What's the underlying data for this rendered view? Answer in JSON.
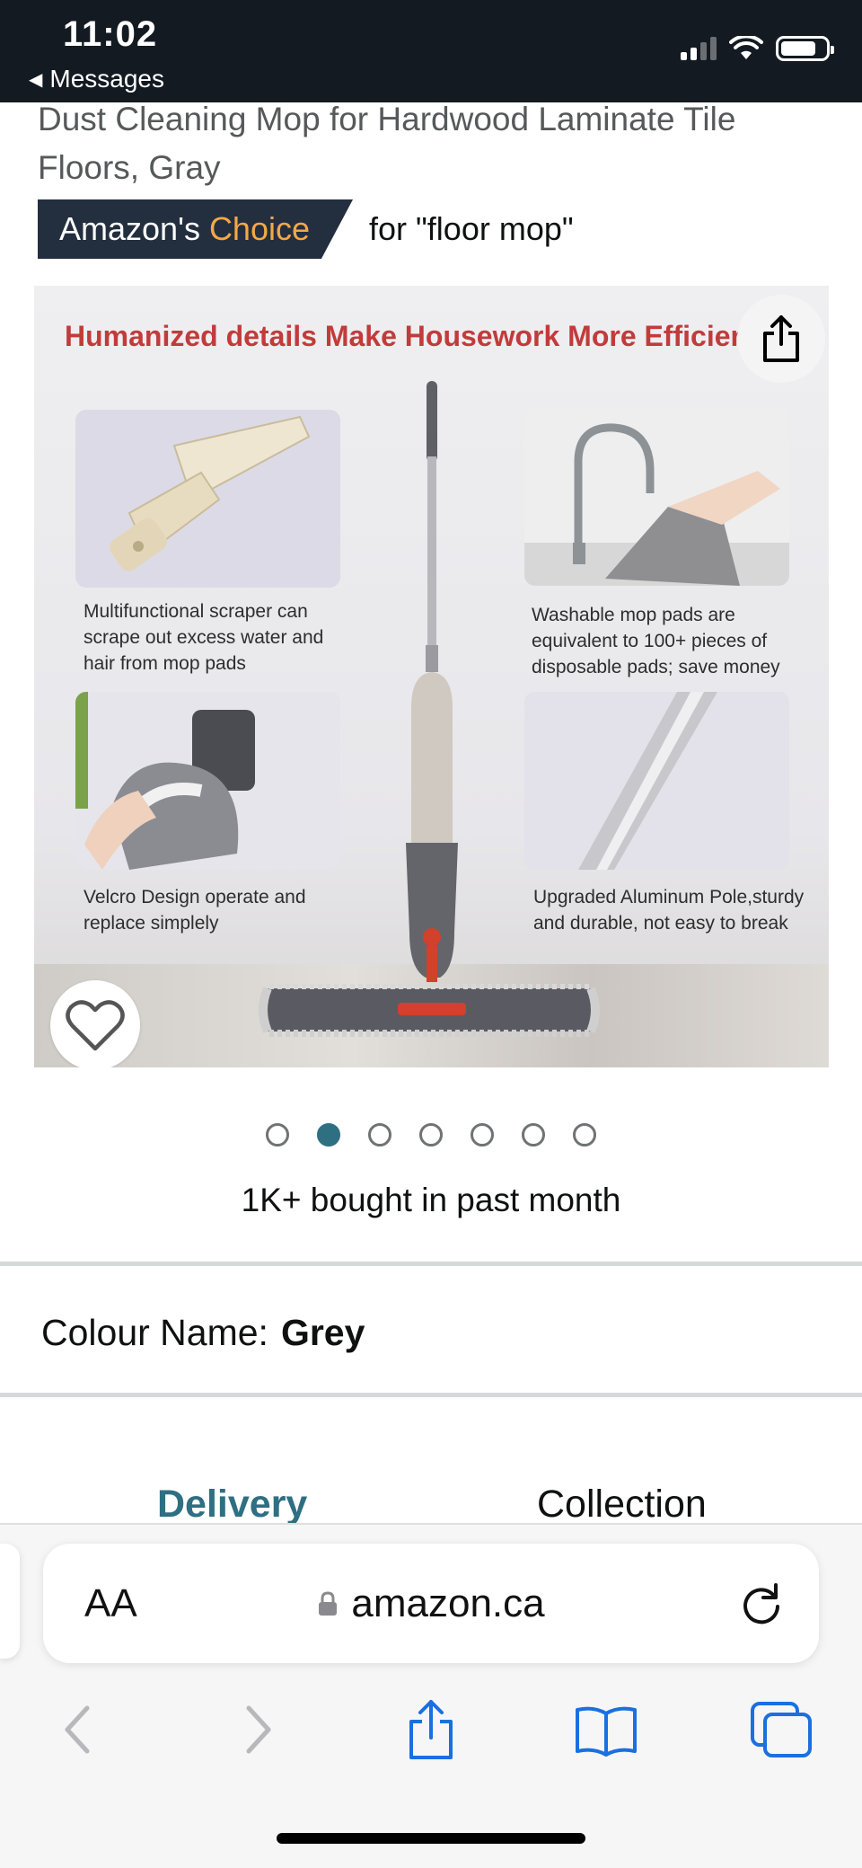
{
  "status_bar": {
    "time": "11:02",
    "back_label": "Messages"
  },
  "product": {
    "title": "Dust Cleaning Mop for Hardwood Laminate Tile Floors, Gray",
    "badge_prefix": "Amazon's",
    "badge_highlight": "Choice",
    "badge_for": "for \"floor mop\""
  },
  "image": {
    "headline": "Humanized details Make Housework More Efficient",
    "captions": [
      "Multifunctional scraper can scrape out excess water and hair from mop pads",
      "Washable mop pads are equivalent to 100+ pieces of disposable pads; save money",
      "Velcro Design operate and replace simplely",
      "Upgraded Aluminum Pole,sturdy and durable, not easy to break"
    ]
  },
  "carousel": {
    "total": 7,
    "active_index": 1
  },
  "social_proof": "1K+ bought in past month",
  "colour": {
    "label": "Colour Name:",
    "value": "Grey"
  },
  "fulfilment_tabs": {
    "delivery": "Delivery",
    "collection": "Collection"
  },
  "browser": {
    "text_size_label": "AA",
    "url": "amazon.ca",
    "icons": [
      "lock-icon",
      "reload-icon",
      "back-arrow-icon",
      "forward-arrow-icon",
      "share-icon",
      "bookmarks-icon",
      "tabs-icon"
    ]
  },
  "colors": {
    "accent_teal": "#2e6f82",
    "badge_bg": "#232f3e",
    "badge_orange": "#f3a847",
    "headline_red": "#c23b3b"
  }
}
